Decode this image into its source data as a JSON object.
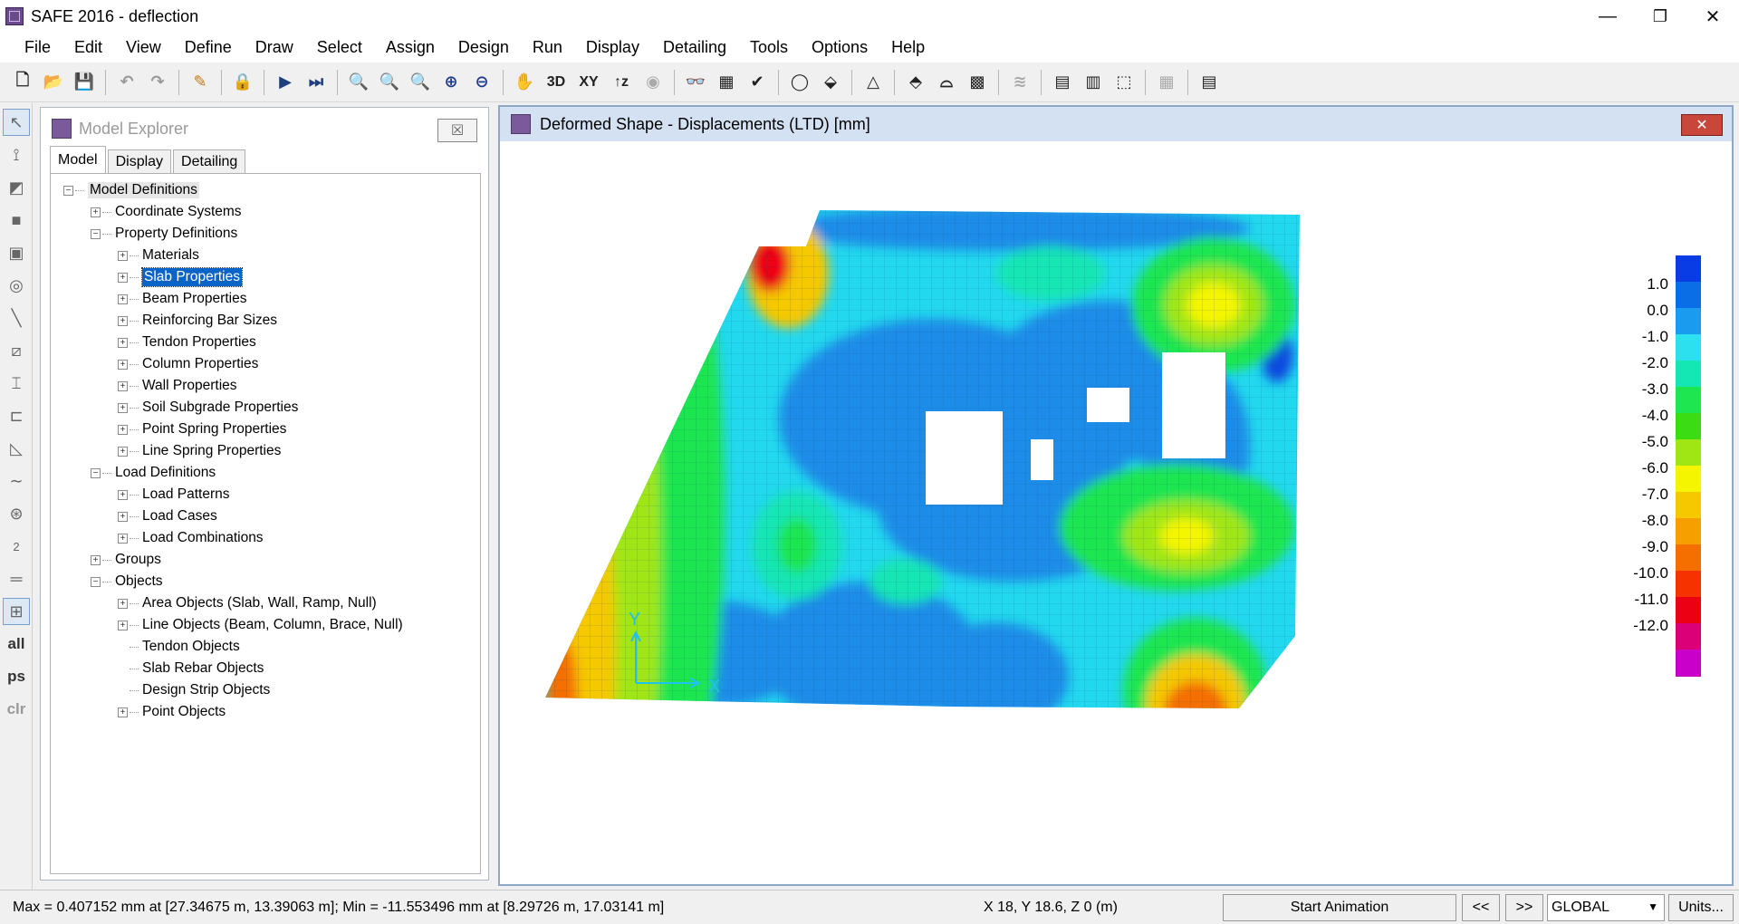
{
  "app": {
    "title": "SAFE 2016 - deflection",
    "window_controls": {
      "minimize": "—",
      "maximize": "❐",
      "close": "✕"
    }
  },
  "menu": [
    "File",
    "Edit",
    "View",
    "Define",
    "Draw",
    "Select",
    "Assign",
    "Design",
    "Run",
    "Display",
    "Detailing",
    "Tools",
    "Options",
    "Help"
  ],
  "toolbar": {
    "text_buttons": {
      "view3d": "3D",
      "viewxy": "XY",
      "viewz": "↑z"
    }
  },
  "left_tools": {
    "all": "all",
    "ps": "ps",
    "clr": "clr",
    "grid": "2"
  },
  "explorer": {
    "title": "Model Explorer",
    "tabs": [
      "Model",
      "Display",
      "Detailing"
    ],
    "tree": [
      {
        "label": "Model Definitions",
        "level": 0,
        "box": "−",
        "root": true
      },
      {
        "label": "Coordinate Systems",
        "level": 1,
        "box": "+"
      },
      {
        "label": "Property Definitions",
        "level": 1,
        "box": "−"
      },
      {
        "label": "Materials",
        "level": 2,
        "box": "+"
      },
      {
        "label": "Slab Properties",
        "level": 2,
        "box": "+",
        "selected": true
      },
      {
        "label": "Beam Properties",
        "level": 2,
        "box": "+"
      },
      {
        "label": "Reinforcing Bar Sizes",
        "level": 2,
        "box": "+"
      },
      {
        "label": "Tendon Properties",
        "level": 2,
        "box": "+"
      },
      {
        "label": "Column Properties",
        "level": 2,
        "box": "+"
      },
      {
        "label": "Wall Properties",
        "level": 2,
        "box": "+"
      },
      {
        "label": "Soil Subgrade Properties",
        "level": 2,
        "box": "+"
      },
      {
        "label": "Point Spring Properties",
        "level": 2,
        "box": "+"
      },
      {
        "label": "Line Spring Properties",
        "level": 2,
        "box": "+"
      },
      {
        "label": "Load Definitions",
        "level": 1,
        "box": "−"
      },
      {
        "label": "Load Patterns",
        "level": 2,
        "box": "+"
      },
      {
        "label": "Load Cases",
        "level": 2,
        "box": "+"
      },
      {
        "label": "Load Combinations",
        "level": 2,
        "box": "+"
      },
      {
        "label": "Groups",
        "level": 1,
        "box": "+"
      },
      {
        "label": "Objects",
        "level": 1,
        "box": "−"
      },
      {
        "label": "Area Objects (Slab, Wall, Ramp, Null)",
        "level": 2,
        "box": "+"
      },
      {
        "label": "Line Objects (Beam, Column, Brace, Null)",
        "level": 2,
        "box": "+"
      },
      {
        "label": "Tendon Objects",
        "level": 2,
        "box": ""
      },
      {
        "label": "Slab Rebar Objects",
        "level": 2,
        "box": ""
      },
      {
        "label": "Design Strip Objects",
        "level": 2,
        "box": ""
      },
      {
        "label": "Point Objects",
        "level": 2,
        "box": "+"
      }
    ]
  },
  "view": {
    "title": "Deformed Shape - Displacements (LTD)  [mm]",
    "axis_x": "X",
    "axis_y": "Y",
    "legend": {
      "labels": [
        "1.0",
        "0.0",
        "-1.0",
        "-2.0",
        "-3.0",
        "-4.0",
        "-5.0",
        "-6.0",
        "-7.0",
        "-8.0",
        "-9.0",
        "-10.0",
        "-11.0",
        "-12.0"
      ],
      "colors": [
        "#0a3ce6",
        "#0a6ee6",
        "#1a9bf0",
        "#2ce0f0",
        "#14e6b4",
        "#1ee650",
        "#3cdc14",
        "#a0e614",
        "#f5f500",
        "#f5c800",
        "#f5a000",
        "#f56e00",
        "#f53200",
        "#eb0014",
        "#dc0078",
        "#c800c8"
      ]
    }
  },
  "status": {
    "text": "Max = 0.407152 mm at [27.34675 m, 13.39063 m];  Min = -11.553496 mm at [8.29726 m, 17.03141 m]",
    "coords": "X 18,  Y 18.6,  Z 0  (m)",
    "start_animation": "Start Animation",
    "prev": "<<",
    "next": ">>",
    "coord_system": "GLOBAL",
    "units": "Units..."
  }
}
